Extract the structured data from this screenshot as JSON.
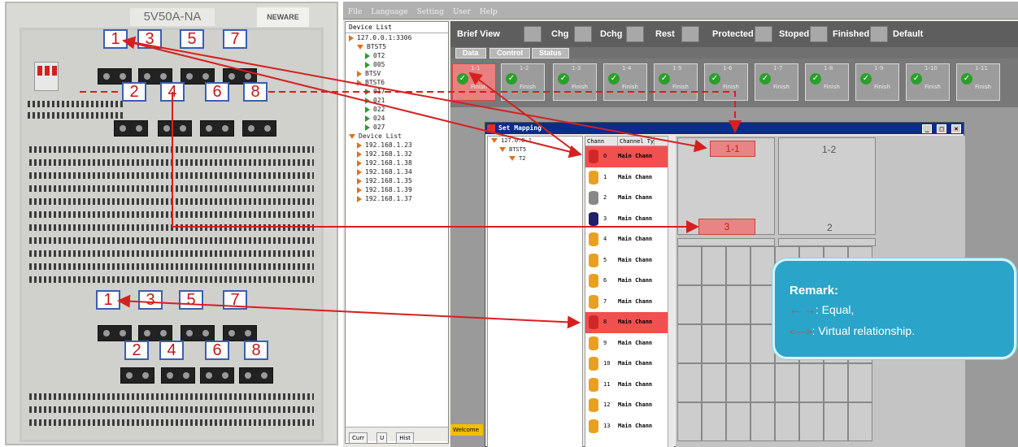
{
  "cabinet": {
    "model_label": "5V50A-NA",
    "brand_label": "NEWARE",
    "top_numbers_row1": [
      "1",
      "3",
      "5",
      "7"
    ],
    "top_numbers_row2": [
      "2",
      "4",
      "6",
      "8"
    ],
    "bottom_numbers_row1": [
      "1",
      "3",
      "5",
      "7"
    ],
    "bottom_numbers_row2": [
      "2",
      "4",
      "6",
      "8"
    ]
  },
  "menubar": [
    "File",
    "Language",
    "Setting",
    "User",
    "Help"
  ],
  "device_tree": {
    "title": "Device List",
    "rows": [
      {
        "label": "127.0.0.1:3306",
        "icon": "tri-right-orange",
        "indent": 0
      },
      {
        "label": "BTST5",
        "icon": "tri-down-orange",
        "indent": 1
      },
      {
        "label": "0T2",
        "icon": "check-green",
        "indent": 2
      },
      {
        "label": "005",
        "icon": "tri-right-green",
        "indent": 2
      },
      {
        "label": "BTSV",
        "icon": "tri-right-orange",
        "indent": 1
      },
      {
        "label": "BTST6",
        "icon": "tri-right-orange",
        "indent": 1
      },
      {
        "label": "017",
        "icon": "tri-right-green",
        "indent": 2
      },
      {
        "label": "021",
        "icon": "tri-right-green",
        "indent": 2
      },
      {
        "label": "022",
        "icon": "tri-right-green",
        "indent": 2
      },
      {
        "label": "024",
        "icon": "tri-right-green",
        "indent": 2
      },
      {
        "label": "027",
        "icon": "tri-right-green",
        "indent": 2
      },
      {
        "label": "Device List",
        "icon": "tri-down-orange",
        "indent": 0
      },
      {
        "label": "192.168.1.23",
        "icon": "tri-right-orange",
        "indent": 1
      },
      {
        "label": "192.168.1.32",
        "icon": "tri-right-orange",
        "indent": 1
      },
      {
        "label": "192.168.1.38",
        "icon": "tri-right-orange",
        "indent": 1
      },
      {
        "label": "192.168.1.34",
        "icon": "tri-right-orange",
        "indent": 1
      },
      {
        "label": "192.168.1.35",
        "icon": "tri-right-orange",
        "indent": 1
      },
      {
        "label": "192.168.1.39",
        "icon": "tri-right-orange",
        "indent": 1
      },
      {
        "label": "192.168.1.37",
        "icon": "tri-right-orange",
        "indent": 1
      }
    ],
    "bottom_tabs": [
      "Curr",
      "U",
      "Hist"
    ]
  },
  "brief_bar": {
    "title": "Brief View",
    "legend": [
      "Chg",
      "Dchg",
      "Rest",
      "Protected",
      "Stoped",
      "Finished",
      "Default"
    ]
  },
  "tabs": [
    "Data",
    "Control",
    "Status"
  ],
  "channels": [
    {
      "id": "1-1",
      "status": "Finish",
      "selected": true
    },
    {
      "id": "1-2",
      "status": "Finish",
      "selected": false
    },
    {
      "id": "1-3",
      "status": "Finish",
      "selected": false
    },
    {
      "id": "1-4",
      "status": "Finish",
      "selected": false
    },
    {
      "id": "1-5",
      "status": "Finish",
      "selected": false
    },
    {
      "id": "1-6",
      "status": "Finish",
      "selected": false
    },
    {
      "id": "1-7",
      "status": "Finish",
      "selected": false
    },
    {
      "id": "1-8",
      "status": "Finish",
      "selected": false
    },
    {
      "id": "1-9",
      "status": "Finish",
      "selected": false
    },
    {
      "id": "1-10",
      "status": "Finish",
      "selected": false
    },
    {
      "id": "1-11",
      "status": "Finish",
      "selected": false
    }
  ],
  "dialog": {
    "title": "Set Mapping",
    "window_buttons": [
      "_",
      "□",
      "×"
    ],
    "tree": [
      {
        "label": "127.0.0.1",
        "indent": 0
      },
      {
        "label": "BTST5",
        "indent": 1
      },
      {
        "label": "T2",
        "indent": 2
      }
    ],
    "list_headers": [
      "Chann",
      "Channel Ty"
    ],
    "list_rows": [
      {
        "num": "0",
        "name": "Main Chann",
        "highlight": true,
        "icon": "red"
      },
      {
        "num": "1",
        "name": "Main Chann",
        "highlight": false,
        "icon": "orange"
      },
      {
        "num": "2",
        "name": "Main Chann",
        "highlight": false,
        "icon": "gray"
      },
      {
        "num": "3",
        "name": "Main Chann",
        "highlight": false,
        "icon": "blue"
      },
      {
        "num": "4",
        "name": "Main Chann",
        "highlight": false,
        "icon": "orange"
      },
      {
        "num": "5",
        "name": "Main Chann",
        "highlight": false,
        "icon": "orange"
      },
      {
        "num": "6",
        "name": "Main Chann",
        "highlight": false,
        "icon": "orange"
      },
      {
        "num": "7",
        "name": "Main Chann",
        "highlight": false,
        "icon": "orange"
      },
      {
        "num": "8",
        "name": "Main Chann",
        "highlight": true,
        "icon": "red"
      },
      {
        "num": "9",
        "name": "Main Chann",
        "highlight": false,
        "icon": "orange"
      },
      {
        "num": "10",
        "name": "Main Chann",
        "highlight": false,
        "icon": "orange"
      },
      {
        "num": "11",
        "name": "Main Chann",
        "highlight": false,
        "icon": "orange"
      },
      {
        "num": "12",
        "name": "Main Chann",
        "highlight": false,
        "icon": "orange"
      },
      {
        "num": "13",
        "name": "Main Chann",
        "highlight": false,
        "icon": "orange"
      }
    ],
    "map_labels": {
      "a": "1-1",
      "b": "1-2",
      "c": "3",
      "d": "2"
    }
  },
  "status_text": "Welcome",
  "remark": {
    "title": "Remark:",
    "equal_symbol": "← →",
    "equal_text": ": Equal,",
    "virtual_symbol": "<---->",
    "virtual_text": ": Virtual relationship."
  },
  "colors": {
    "annotation_red": "#d62020",
    "box_border_blue": "#3a5fb0",
    "remark_bg": "#2aa4c8",
    "title_blue": "#0c2b8c"
  }
}
